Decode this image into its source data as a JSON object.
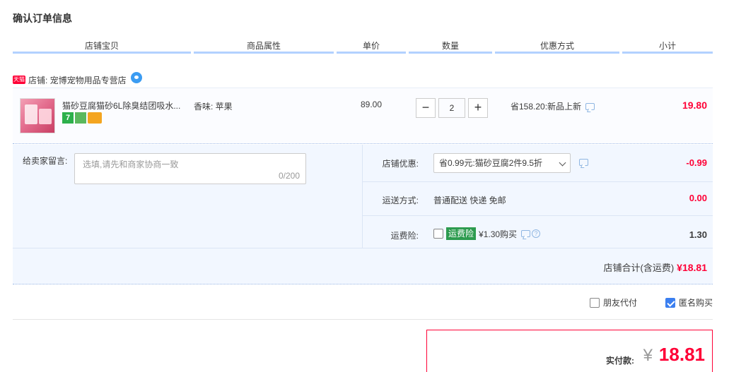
{
  "page": {
    "title": "确认订单信息"
  },
  "columns": [
    "店铺宝贝",
    "商品属性",
    "单价",
    "数量",
    "优惠方式",
    "小计"
  ],
  "shop": {
    "tmall_badge": "天猫",
    "label": "店铺: 宠博宠物用品专营店"
  },
  "item": {
    "title": "猫砂豆腐猫砂6L除臭结团吸水...",
    "attribute": "香味: 苹果",
    "price": "89.00",
    "quantity": "2",
    "minus": "−",
    "plus": "+",
    "promotion": "省158.20:新品上新",
    "subtotal": "19.80",
    "badges": {
      "seven": "7"
    }
  },
  "message": {
    "label": "给卖家留言:",
    "placeholder": "选填,请先和商家协商一致",
    "counter": "0/200"
  },
  "shop_discount": {
    "label": "店铺优惠:",
    "selected": "省0.99元:猫砂豆腐2件9.5折",
    "amount": "-0.99"
  },
  "shipping": {
    "label": "运送方式:",
    "value": "普通配送 快递 免邮",
    "amount": "0.00"
  },
  "insurance": {
    "label": "运费险:",
    "tag": "运费险",
    "price": "¥1.30购买",
    "amount": "1.30"
  },
  "shop_total": {
    "label": "店铺合计(含运费)",
    "amount": "¥18.81"
  },
  "options": {
    "friend_pay": "朋友代付",
    "anonymous": "匿名购买",
    "anonymous_checked": true
  },
  "payment": {
    "label": "实付款:",
    "currency": "¥",
    "amount": "18.81"
  },
  "colors": {
    "accent_red": "#ff0036",
    "header_line": "#b2d1ff",
    "panel_bg": "#f2f7ff"
  }
}
